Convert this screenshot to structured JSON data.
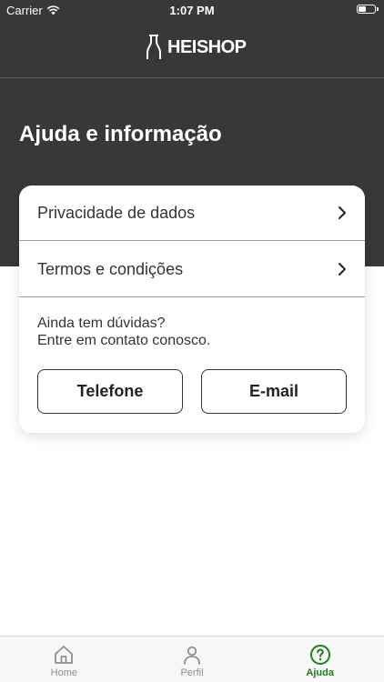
{
  "status_bar": {
    "carrier": "Carrier",
    "time": "1:07 PM"
  },
  "header": {
    "logo_text": "HEISHOP"
  },
  "page": {
    "title": "Ajuda e informação"
  },
  "menu": {
    "items": [
      {
        "label": "Privacidade de dados",
        "icon": "chevron-right-icon"
      },
      {
        "label": "Termos e condições",
        "icon": "chevron-right-icon"
      }
    ]
  },
  "contact": {
    "line1": "Ainda tem dúvidas?",
    "line2": "Entre em contato conosco.",
    "phone_label": "Telefone",
    "email_label": "E-mail"
  },
  "tabs": [
    {
      "label": "Home",
      "icon": "home-icon",
      "active": false
    },
    {
      "label": "Perfil",
      "icon": "profile-icon",
      "active": false
    },
    {
      "label": "Ajuda",
      "icon": "help-icon",
      "active": true
    }
  ],
  "colors": {
    "header_bg": "#383838",
    "accent": "#1e7d1e",
    "inactive_tab": "#8e8e8e"
  }
}
